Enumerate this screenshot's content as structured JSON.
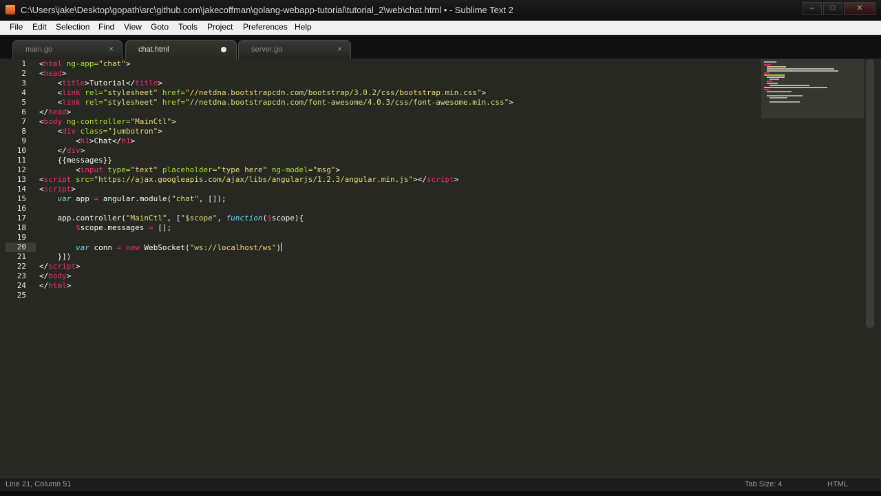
{
  "window": {
    "title": "C:\\Users\\jake\\Desktop\\gopath\\src\\github.com\\jakecoffman\\golang-webapp-tutorial\\tutorial_2\\web\\chat.html • - Sublime Text 2",
    "minimize_glyph": "–",
    "maximize_glyph": "□",
    "close_glyph": "✕"
  },
  "menu": [
    "File",
    "Edit",
    "Selection",
    "Find",
    "View",
    "Goto",
    "Tools",
    "Project",
    "Preferences",
    "Help"
  ],
  "tabs": [
    {
      "label": "main.go",
      "close": "×"
    },
    {
      "label": "chat.html",
      "close": ""
    },
    {
      "label": "server.go",
      "close": "×"
    }
  ],
  "line_numbers": [
    "1",
    "2",
    "3",
    "4",
    "5",
    "6",
    "7",
    "8",
    "9",
    "10",
    "11",
    "12",
    "13",
    "14",
    "15",
    "16",
    "17",
    "18",
    "19",
    "20",
    "21",
    "22",
    "23",
    "24",
    "25"
  ],
  "code": {
    "l1": {
      "t1": "<",
      "t2": "html",
      "t3": " ng-app=",
      "t4": "\"chat\"",
      "t5": ">"
    },
    "l2": {
      "t1": "<",
      "t2": "head",
      "t3": ">"
    },
    "l3": {
      "t1": "    <",
      "t2": "title",
      "t3": ">Tutorial</",
      "t4": "title",
      "t5": ">"
    },
    "l4": {
      "t1": "    <",
      "t2": "link",
      "t3": " rel=",
      "t4": "\"stylesheet\"",
      "t5": " href=",
      "t6": "\"//netdna.bootstrapcdn.com/bootstrap/3.0.2/css/bootstrap.min.css\"",
      "t7": ">"
    },
    "l5": {
      "t1": "    <",
      "t2": "link",
      "t3": " rel=",
      "t4": "\"stylesheet\"",
      "t5": " href=",
      "t6": "\"//netdna.bootstrapcdn.com/font-awesome/4.0.3/css/font-awesome.min.css\"",
      "t7": ">"
    },
    "l6": {
      "t1": "</",
      "t2": "head",
      "t3": ">"
    },
    "l7": {
      "t1": "<",
      "t2": "body",
      "t3": " ng-controller=",
      "t4": "\"MainCtl\"",
      "t5": ">"
    },
    "l8": {
      "t1": "    <",
      "t2": "div",
      "t3": " class=",
      "t4": "\"jumbotron\"",
      "t5": ">"
    },
    "l9": {
      "t1": "        <",
      "t2": "h1",
      "t3": ">Chat</",
      "t4": "h1",
      "t5": ">"
    },
    "l10": {
      "t1": "    </",
      "t2": "div",
      "t3": ">"
    },
    "l11": {
      "t1": "    {{messages}}"
    },
    "l12": {
      "t1": "        <",
      "t2": "input",
      "t3": " type=",
      "t4": "\"text\"",
      "t5": " placeholder=",
      "t6": "\"type here\"",
      "t7": " ng-model=",
      "t8": "\"msg\"",
      "t9": ">"
    },
    "l13": {
      "t1": "<",
      "t2": "script",
      "t3": " src=",
      "t4": "\"https://ajax.googleapis.com/ajax/libs/angularjs/1.2.3/angular.min.js\"",
      "t5": "></",
      "t6": "script",
      "t7": ">"
    },
    "l14": {
      "t1": "<",
      "t2": "script",
      "t3": ">"
    },
    "l15": {
      "t1": "    ",
      "t2": "var",
      "t3": " app ",
      "t4": "=",
      "t5": " angular.module(",
      "t6": "\"chat\"",
      "t7": ", []);"
    },
    "l17": {
      "t1": "    app.controller(",
      "t2": "\"MainCtl\"",
      "t3": ", [",
      "t4": "\"$scope\"",
      "t5": ", ",
      "t6": "function",
      "t7": "(",
      "t8": "$",
      "t9": "scope){"
    },
    "l18": {
      "t1": "        ",
      "t2": "$",
      "t3": "scope.messages ",
      "t4": "=",
      "t5": " [];"
    },
    "l20": {
      "t1": "        ",
      "t2": "var",
      "t3": " conn ",
      "t4": "=",
      "t5": " ",
      "t6": "new",
      "t7": " WebSocket(",
      "t8": "\"ws://localhost/ws\"",
      "t9": ")"
    },
    "l21": {
      "t1": "    }])"
    },
    "l22": {
      "t1": "</",
      "t2": "script",
      "t3": ">"
    },
    "l23": {
      "t1": "</",
      "t2": "body",
      "t3": ">"
    },
    "l24": {
      "t1": "</",
      "t2": "html",
      "t3": ">"
    }
  },
  "status": {
    "left": "Line 21, Column 51",
    "syntax_indent": "Tab Size: 4",
    "syntax": "HTML"
  },
  "colors": {
    "editor_bg": "#272822",
    "tag": "#f92672",
    "attribute": "#a6e22e",
    "string": "#e6db74",
    "keyword": "#66d9ef",
    "text": "#f8f8f2"
  }
}
